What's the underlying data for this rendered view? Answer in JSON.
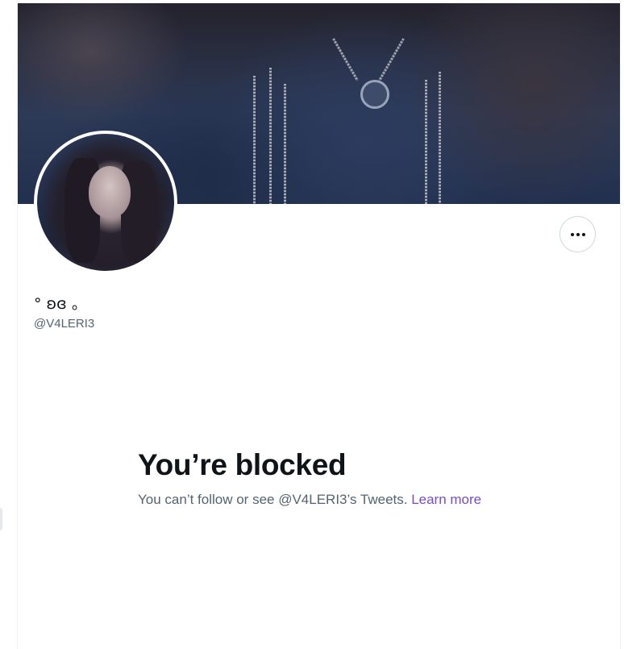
{
  "profile": {
    "display_name": "° ʚɞ 。",
    "handle": "@V4LERI3"
  },
  "more_button": {
    "icon": "more-horizontal-icon"
  },
  "blocked": {
    "title": "You’re blocked",
    "message": "You can’t follow or see @V4LERI3’s Tweets. ",
    "learn_more": "Learn more"
  },
  "colors": {
    "text_primary": "#0f1419",
    "text_secondary": "#536471",
    "link": "#794bc4",
    "border": "#cfd9de"
  }
}
